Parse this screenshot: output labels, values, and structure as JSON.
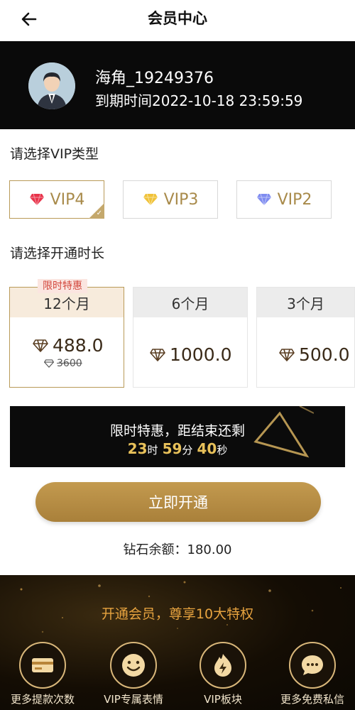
{
  "header": {
    "title": "会员中心"
  },
  "profile": {
    "username": "海角_19249376",
    "expire": "到期时间2022-10-18 23:59:59"
  },
  "vip_section": {
    "label": "请选择VIP类型",
    "types": [
      {
        "label": "VIP4",
        "gem_color": "#e8334a",
        "selected": true
      },
      {
        "label": "VIP3",
        "gem_color": "#f0c238",
        "selected": false
      },
      {
        "label": "VIP2",
        "gem_color": "#7f8cf0",
        "selected": false
      }
    ]
  },
  "duration_section": {
    "label": "请选择开通时长",
    "options": [
      {
        "label": "12个月",
        "price": "488.0",
        "old_price": "3600",
        "tag": "限时特惠",
        "selected": true
      },
      {
        "label": "6个月",
        "price": "1000.0",
        "selected": false
      },
      {
        "label": "3个月",
        "price": "500.0",
        "selected": false
      }
    ]
  },
  "countdown": {
    "text": "限时特惠，距结束还剩",
    "hours": "23",
    "hours_unit": "时",
    "minutes": "59",
    "minutes_unit": "分",
    "seconds": "40",
    "seconds_unit": "秒"
  },
  "open_button": "立即开通",
  "balance": "钻石余额：180.00",
  "privileges": {
    "title": "开通会员，尊享10大特权",
    "items": [
      {
        "label": "更多提款次数",
        "icon": "card-icon"
      },
      {
        "label": "VIP专属表情",
        "icon": "smile-icon"
      },
      {
        "label": "VIP板块",
        "icon": "flame-icon"
      },
      {
        "label": "更多免费私信",
        "icon": "chat-icon"
      }
    ]
  },
  "colors": {
    "gold": "#b99a58",
    "accent_red": "#d2463b",
    "countdown_num": "#e8c15a"
  }
}
